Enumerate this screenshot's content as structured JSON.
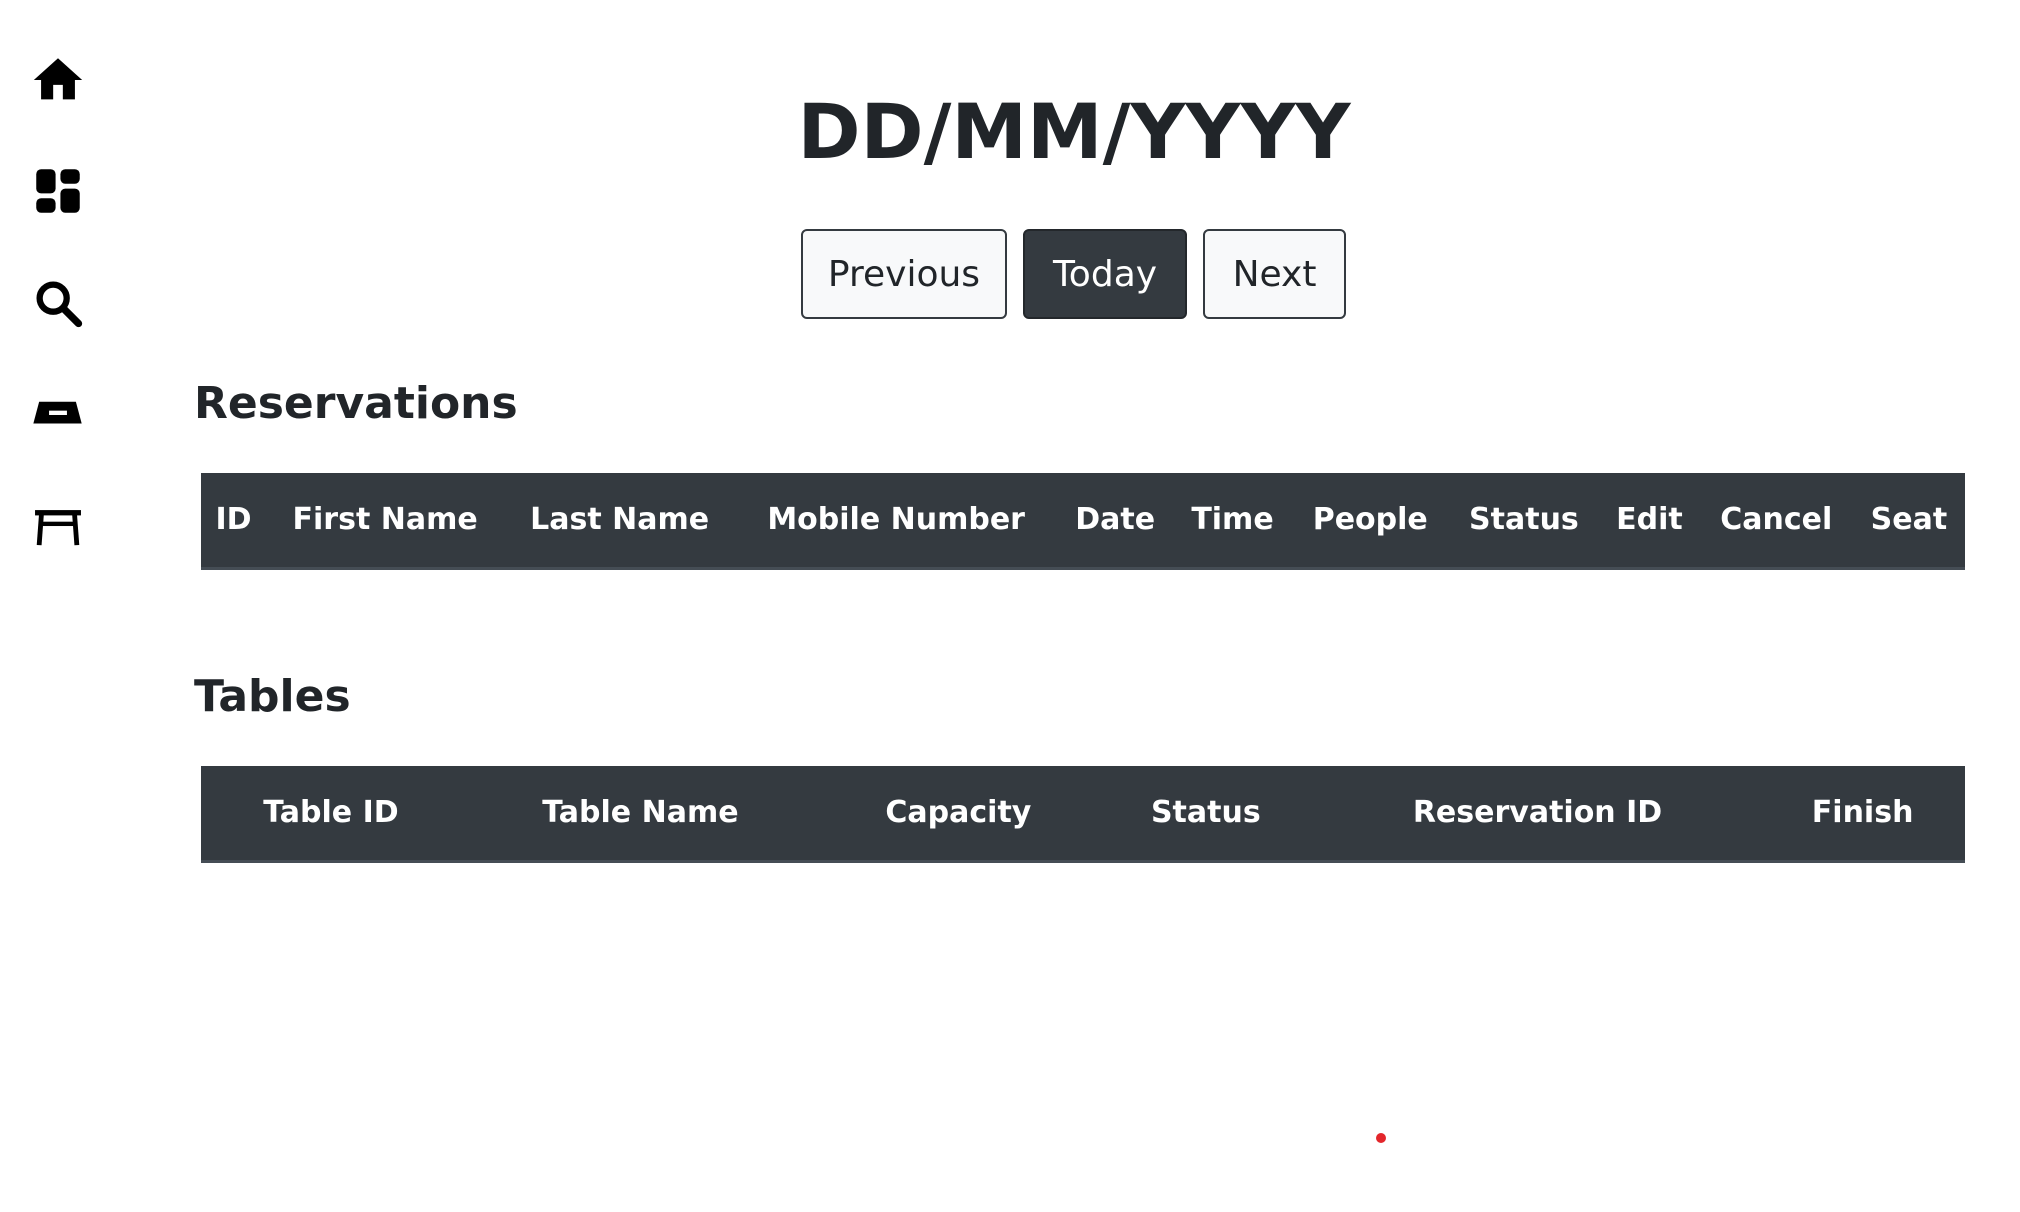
{
  "sidebar": {
    "items": [
      {
        "icon": "home-icon",
        "label": "Home"
      },
      {
        "icon": "dashboard-icon",
        "label": "Dashboard"
      },
      {
        "icon": "search-icon",
        "label": "Search"
      },
      {
        "icon": "new-reservation-icon",
        "label": "New Reservation"
      },
      {
        "icon": "table-icon",
        "label": "New Table"
      }
    ]
  },
  "header": {
    "date": "DD/MM/YYYY",
    "buttons": {
      "previous": "Previous",
      "today": "Today",
      "next": "Next"
    }
  },
  "reservations": {
    "title": "Reservations",
    "columns": [
      "ID",
      "First Name",
      "Last Name",
      "Mobile Number",
      "Date",
      "Time",
      "People",
      "Status",
      "Edit",
      "Cancel",
      "Seat"
    ],
    "rows": []
  },
  "tables": {
    "title": "Tables",
    "columns": [
      "Table ID",
      "Table Name",
      "Capacity",
      "Status",
      "Reservation ID",
      "Finish"
    ],
    "rows": []
  },
  "colors": {
    "dark": "#343a40",
    "text": "#212529",
    "light_button": "#f8f9fa",
    "dot": "#e3262b"
  }
}
